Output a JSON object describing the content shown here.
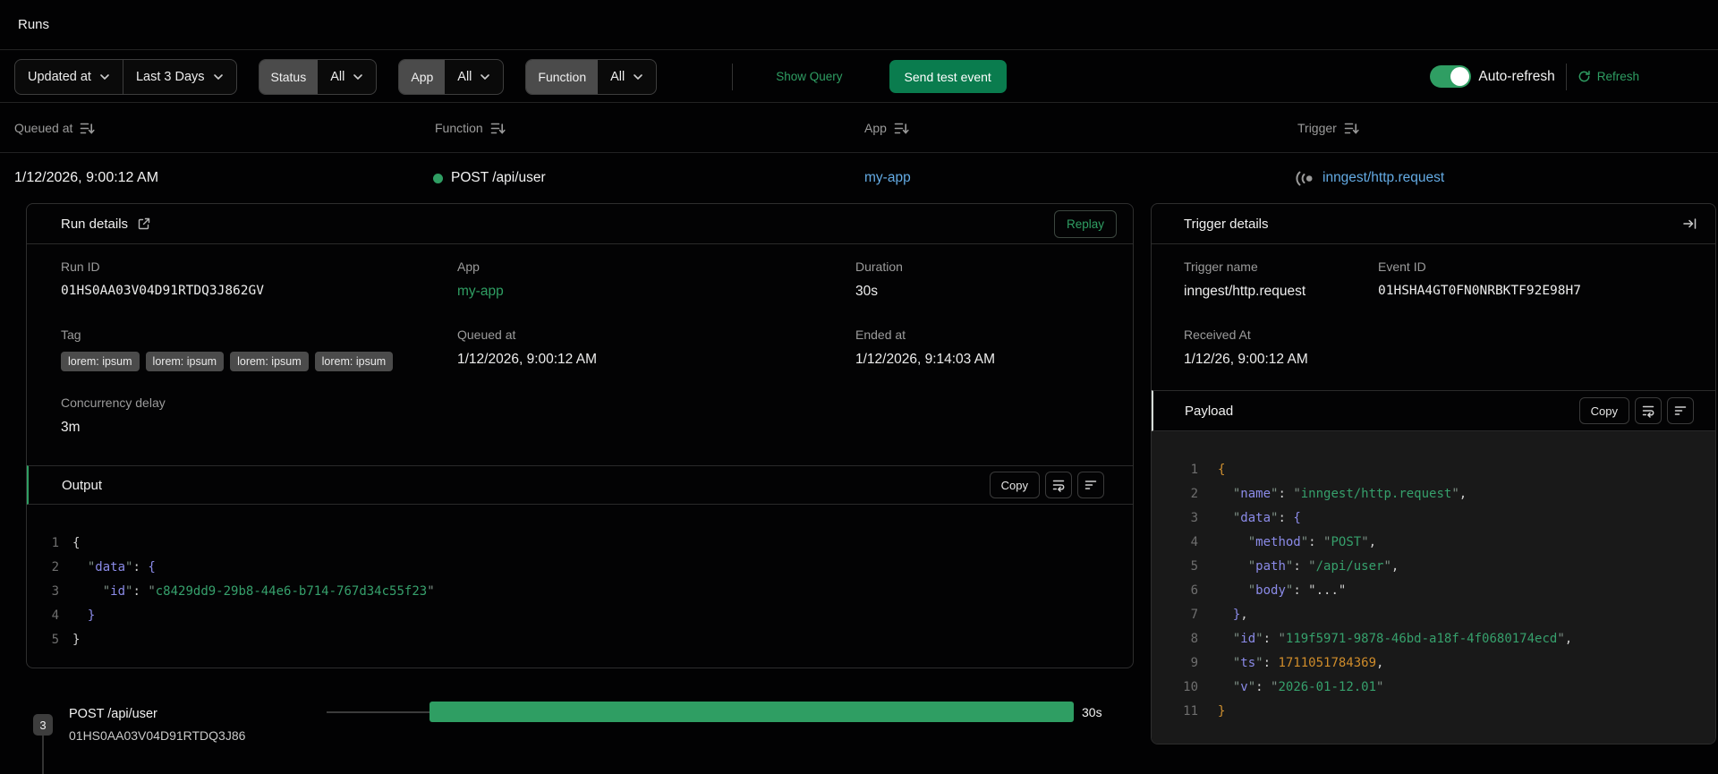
{
  "page": {
    "title": "Runs"
  },
  "colors": {
    "accent_green": "#2f9e63",
    "button_green": "#0a7c4e",
    "link_blue": "#64abe4",
    "status_green": "#2f9e63"
  },
  "filters": {
    "time_field": "Updated at",
    "date_range": "Last 3 Days",
    "status": {
      "label": "Status",
      "value": "All"
    },
    "app": {
      "label": "App",
      "value": "All"
    },
    "function": {
      "label": "Function",
      "value": "All"
    },
    "show_query": "Show Query",
    "send_test_event": "Send test event",
    "auto_refresh": {
      "label": "Auto-refresh",
      "enabled": true
    },
    "refresh": "Refresh"
  },
  "table": {
    "columns": [
      {
        "label": "Queued at",
        "sort_icon": "bars-arrow-down"
      },
      {
        "label": "Function",
        "sort_icon": "bars-arrow-down"
      },
      {
        "label": "App",
        "sort_icon": "bars-arrow-down"
      },
      {
        "label": "Trigger",
        "sort_icon": "bars-arrow-down"
      }
    ],
    "row": {
      "queued_at": "1/12/2026, 9:00:12 AM",
      "function": "POST /api/user",
      "app": "my-app",
      "trigger": "inngest/http.request",
      "trigger_icon": "webhook-signal"
    }
  },
  "run_details": {
    "title": "Run details",
    "open_icon": "external-link",
    "replay_label": "Replay",
    "fields": {
      "run_id": {
        "label": "Run ID",
        "value": "01HS0AA03V04D91RTDQ3J862GV"
      },
      "app": {
        "label": "App",
        "value": "my-app"
      },
      "duration": {
        "label": "Duration",
        "value": "30s"
      },
      "tag": {
        "label": "Tag",
        "values": [
          "lorem: ipsum",
          "lorem: ipsum",
          "lorem: ipsum",
          "lorem: ipsum"
        ]
      },
      "queued_at": {
        "label": "Queued at",
        "value": "1/12/2026, 9:00:12 AM"
      },
      "ended_at": {
        "label": "Ended at",
        "value": "1/12/2026, 9:14:03 AM"
      },
      "concurrency_delay": {
        "label": "Concurrency delay",
        "value": "3m"
      }
    },
    "output": {
      "title": "Output",
      "copy_label": "Copy",
      "icons": [
        "wrap-text",
        "align-left-lines"
      ],
      "lines": [
        [
          [
            "p",
            "{"
          ]
        ],
        [
          [
            "p",
            "  "
          ],
          [
            "q",
            "\""
          ],
          [
            "k",
            "data"
          ],
          [
            "q",
            "\""
          ],
          [
            "p",
            ": "
          ],
          [
            "bp",
            "{"
          ]
        ],
        [
          [
            "p",
            "    "
          ],
          [
            "q",
            "\""
          ],
          [
            "k",
            "id"
          ],
          [
            "q",
            "\""
          ],
          [
            "p",
            ": "
          ],
          [
            "q",
            "\""
          ],
          [
            "s",
            "c8429dd9-29b8-44e6-b714-767d34c55f23"
          ],
          [
            "q",
            "\""
          ]
        ],
        [
          [
            "p",
            "  "
          ],
          [
            "bp",
            "}"
          ]
        ],
        [
          [
            "p",
            "}"
          ]
        ]
      ]
    }
  },
  "trigger_details": {
    "title": "Trigger details",
    "collapse_icon": "arrow-right-to-line",
    "fields": {
      "trigger_name": {
        "label": "Trigger name",
        "value": "inngest/http.request"
      },
      "event_id": {
        "label": "Event ID",
        "value": "01HSHA4GT0FN0NRBKTF92E98H7"
      },
      "received_at": {
        "label": "Received At",
        "value": "1/12/26, 9:00:12 AM"
      }
    },
    "payload": {
      "title": "Payload",
      "copy_label": "Copy",
      "icons": [
        "wrap-text",
        "align-left-lines"
      ],
      "lines": [
        [
          [
            "bo",
            "{"
          ]
        ],
        [
          [
            "p",
            "  "
          ],
          [
            "q",
            "\""
          ],
          [
            "k",
            "name"
          ],
          [
            "q",
            "\""
          ],
          [
            "p",
            ": "
          ],
          [
            "q",
            "\""
          ],
          [
            "s",
            "inngest/http.request"
          ],
          [
            "q",
            "\""
          ],
          [
            "p",
            ","
          ]
        ],
        [
          [
            "p",
            "  "
          ],
          [
            "q",
            "\""
          ],
          [
            "k",
            "data"
          ],
          [
            "q",
            "\""
          ],
          [
            "p",
            ": "
          ],
          [
            "bp",
            "{"
          ]
        ],
        [
          [
            "p",
            "    "
          ],
          [
            "q",
            "\""
          ],
          [
            "k",
            "method"
          ],
          [
            "q",
            "\""
          ],
          [
            "p",
            ": "
          ],
          [
            "q",
            "\""
          ],
          [
            "s",
            "POST"
          ],
          [
            "q",
            "\""
          ],
          [
            "p",
            ","
          ]
        ],
        [
          [
            "p",
            "    "
          ],
          [
            "q",
            "\""
          ],
          [
            "k",
            "path"
          ],
          [
            "q",
            "\""
          ],
          [
            "p",
            ": "
          ],
          [
            "q",
            "\""
          ],
          [
            "s",
            "/api/user"
          ],
          [
            "q",
            "\""
          ],
          [
            "p",
            ","
          ]
        ],
        [
          [
            "p",
            "    "
          ],
          [
            "q",
            "\""
          ],
          [
            "k",
            "body"
          ],
          [
            "q",
            "\""
          ],
          [
            "p",
            ": "
          ],
          [
            "p",
            "\"...\""
          ]
        ],
        [
          [
            "p",
            "  "
          ],
          [
            "bp",
            "}"
          ],
          [
            "p",
            ","
          ]
        ],
        [
          [
            "p",
            "  "
          ],
          [
            "q",
            "\""
          ],
          [
            "k",
            "id"
          ],
          [
            "q",
            "\""
          ],
          [
            "p",
            ": "
          ],
          [
            "q",
            "\""
          ],
          [
            "s",
            "119f5971-9878-46bd-a18f-4f0680174ecd"
          ],
          [
            "q",
            "\""
          ],
          [
            "p",
            ","
          ]
        ],
        [
          [
            "p",
            "  "
          ],
          [
            "q",
            "\""
          ],
          [
            "k",
            "ts"
          ],
          [
            "q",
            "\""
          ],
          [
            "p",
            ": "
          ],
          [
            "n",
            "1711051784369"
          ],
          [
            "p",
            ","
          ]
        ],
        [
          [
            "p",
            "  "
          ],
          [
            "q",
            "\""
          ],
          [
            "k",
            "v"
          ],
          [
            "q",
            "\""
          ],
          [
            "p",
            ": "
          ],
          [
            "q",
            "\""
          ],
          [
            "s",
            "2026-01-12.01"
          ],
          [
            "q",
            "\""
          ]
        ],
        [
          [
            "bo",
            "}"
          ]
        ]
      ]
    }
  },
  "timeline": {
    "step_count": "3",
    "name": "POST /api/user",
    "run_id": "01HS0AA03V04D91RTDQ3J86",
    "duration": "30s"
  }
}
